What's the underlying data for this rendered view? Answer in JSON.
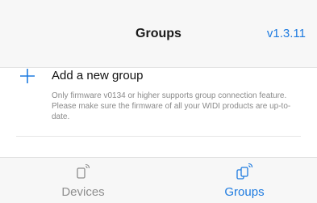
{
  "nav": {
    "title": "Groups",
    "version": "v1.3.11"
  },
  "content": {
    "add_label": "Add a new group",
    "note": "Only firmware v0134 or higher supports group connection feature. Please make sure the firmware of all your WIDI products are up-to-date."
  },
  "tabs": [
    {
      "label": "Devices",
      "icon": "device-icon",
      "active": false
    },
    {
      "label": "Groups",
      "icon": "group-icon",
      "active": true
    }
  ],
  "colors": {
    "accent": "#1e7be0",
    "inactive": "#8e8e8e"
  }
}
